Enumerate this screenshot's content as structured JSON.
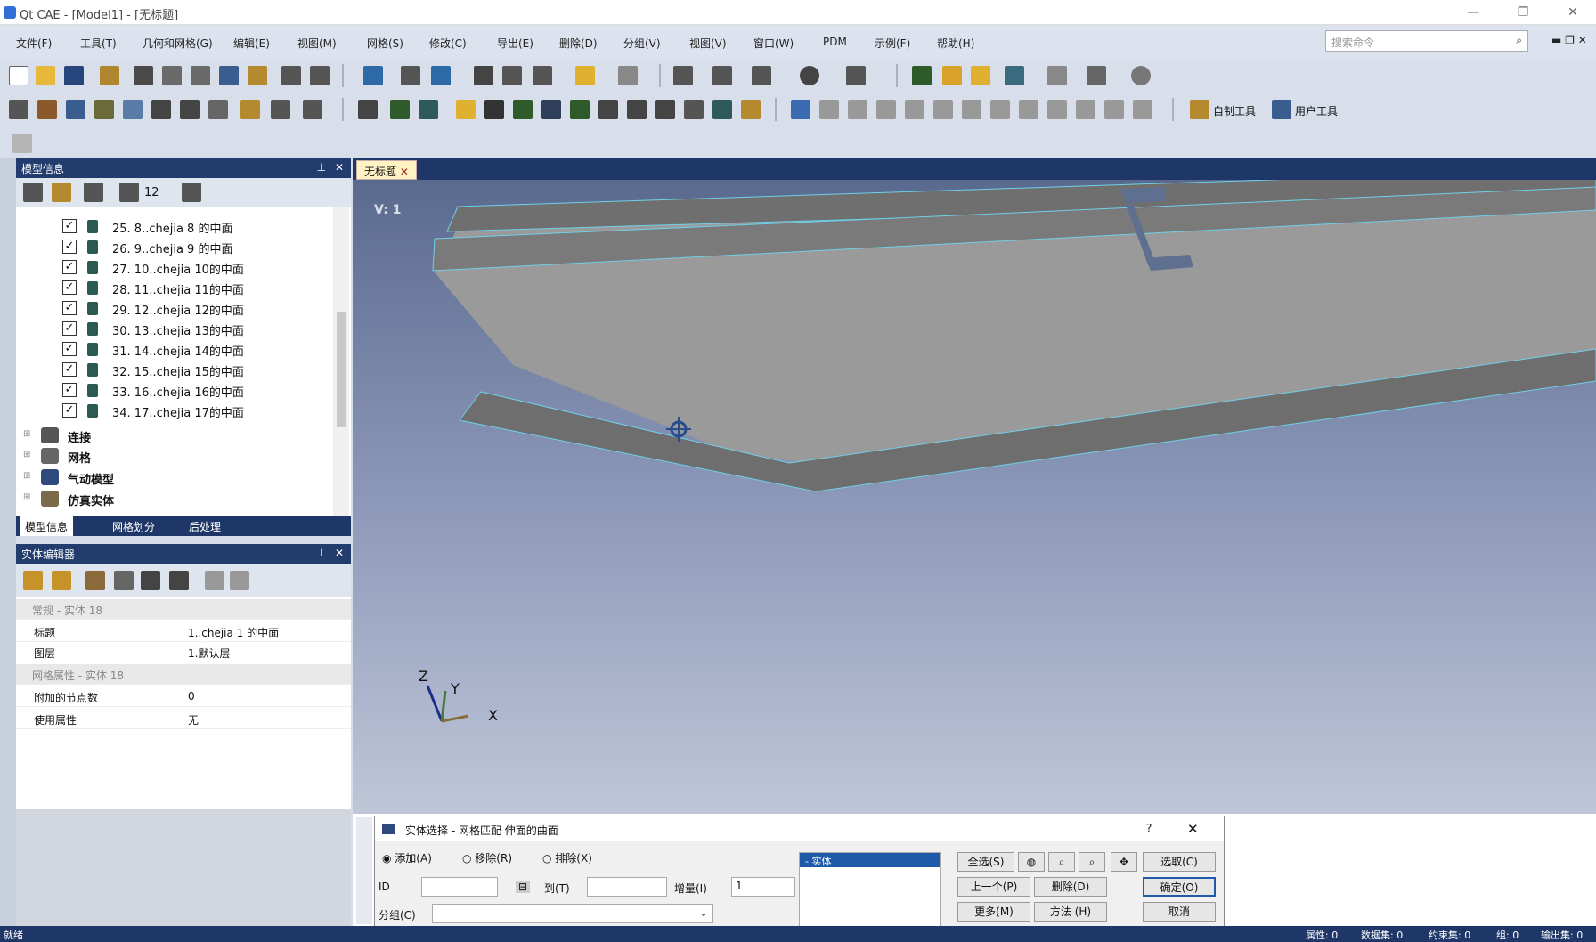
{
  "window": {
    "title": "Qt CAE - [Model1] - [无标题]",
    "min": "—",
    "restore": "❐",
    "close": "✕"
  },
  "menu": [
    "文件(F)",
    "工具(T)",
    "几何和网格(G)",
    "编辑(E)",
    "视图(M)",
    "网格(S)",
    "修改(C)",
    "导出(E)",
    "删除(D)",
    "分组(V)",
    "视图(V)",
    "窗口(W)",
    "PDM",
    "示例(F)",
    "帮助(H)"
  ],
  "search": {
    "placeholder": "搜索命令",
    "icon": "search-icon"
  },
  "toolbar3_custom": [
    "自制工具",
    "用户工具"
  ],
  "model_panel": {
    "title": "模型信息",
    "filter_value": "12",
    "rows": [
      {
        "label": "25. 8..chejia 8 的中面",
        "checked": true
      },
      {
        "label": "26. 9..chejia 9 的中面",
        "checked": true
      },
      {
        "label": "27. 10..chejia 10的中面",
        "checked": true
      },
      {
        "label": "28. 11..chejia 11的中面",
        "checked": true
      },
      {
        "label": "29. 12..chejia 12的中面",
        "checked": true
      },
      {
        "label": "30. 13..chejia 13的中面",
        "checked": true
      },
      {
        "label": "31. 14..chejia 14的中面",
        "checked": true
      },
      {
        "label": "32. 15..chejia 15的中面",
        "checked": true
      },
      {
        "label": "33. 16..chejia 16的中面",
        "checked": true
      },
      {
        "label": "34. 17..chejia 17的中面",
        "checked": true
      }
    ],
    "groups": [
      "连接",
      "网格",
      "气动模型",
      "仿真实体"
    ],
    "tabs": [
      "模型信息",
      "网格划分",
      "后处理"
    ]
  },
  "property_panel": {
    "title": "实体编辑器",
    "cat1": "常规 - 实体 18",
    "rows1": [
      {
        "k": "标题",
        "v": "1..chejia 1 的中面"
      },
      {
        "k": "图层",
        "v": "1.默认层"
      }
    ],
    "cat2": "网格属性 - 实体 18",
    "rows2": [
      {
        "k": "附加的节点数",
        "v": "0"
      },
      {
        "k": "使用属性",
        "v": "无"
      }
    ]
  },
  "viewport": {
    "tab": "无标题",
    "view_label": "V: 1",
    "axes": {
      "z": "Z",
      "y": "Y",
      "x": "X"
    }
  },
  "dialog": {
    "title": "实体选择 - 网格匹配 伸面的曲面",
    "help": "?",
    "radios": [
      "添加(A)",
      "移除(R)",
      "排除(X)"
    ],
    "id_label": "ID",
    "id_value": "",
    "to_label": "到(T)",
    "to_value": "",
    "inc_label": "增量(I)",
    "inc_value": "1",
    "group_label": "分组(C)",
    "group_value": "",
    "list_item": "- 实体",
    "buttons": {
      "select_all": "全选(S)",
      "prev": "上一个(P)",
      "delete": "删除(D)",
      "more": "更多(M)",
      "method": "方法 (H)",
      "pick": "选取(C)",
      "confirm": "确定(O)",
      "cancel": "取消"
    }
  },
  "status": {
    "ready": "就绪",
    "items": [
      "属性: 0",
      "数据集: 0",
      "约束集: 0",
      "组: 0",
      "输出集: 0"
    ]
  }
}
